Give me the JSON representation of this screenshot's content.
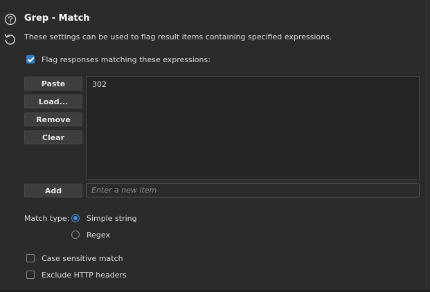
{
  "section": {
    "title": "Grep - Match",
    "description": "These settings can be used to flag result items containing specified expressions."
  },
  "flag_checkbox": {
    "label": "Flag responses matching these expressions:",
    "checked": true
  },
  "buttons": {
    "paste": "Paste",
    "load": "Load...",
    "remove": "Remove",
    "clear": "Clear",
    "add": "Add"
  },
  "list": {
    "items": [
      "302"
    ]
  },
  "new_item": {
    "placeholder": "Enter a new item"
  },
  "match_type": {
    "label": "Match type:",
    "options": [
      {
        "label": "Simple string",
        "selected": true
      },
      {
        "label": "Regex",
        "selected": false
      }
    ]
  },
  "options": {
    "case_sensitive": {
      "label": "Case sensitive match",
      "checked": false
    },
    "exclude_headers": {
      "label": "Exclude HTTP headers",
      "checked": false
    }
  },
  "colors": {
    "accent": "#2f7fd0",
    "background": "#2b2b2b",
    "list_background": "#252525"
  },
  "icons": {
    "help": "help-circle-icon",
    "reset": "reset-icon"
  }
}
